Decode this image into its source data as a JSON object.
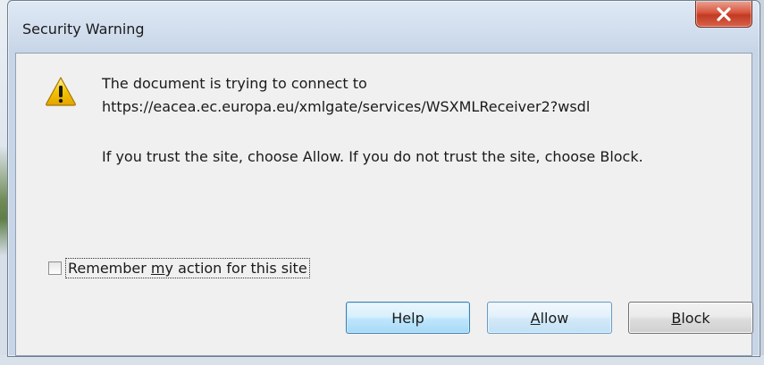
{
  "window": {
    "title": "Security Warning",
    "close_glyph": "X"
  },
  "message": {
    "line1": "The document is trying to connect to",
    "line2": "https://eacea.ec.europa.eu/xmlgate/services/WSXMLReceiver2?wsdl",
    "line3": "If you trust the site, choose Allow. If you do not trust the site, choose Block."
  },
  "remember": {
    "label_before": "Remember ",
    "label_mnemonic": "m",
    "label_after": "y action for this site",
    "checked": false
  },
  "buttons": {
    "help": "Help",
    "allow_mnemonic": "A",
    "allow_rest": "llow",
    "block_mnemonic": "B",
    "block_rest": "lock"
  },
  "icons": {
    "warning": "warning-icon",
    "close": "close-icon"
  },
  "colors": {
    "close_button": "#c23a22",
    "warning_yellow": "#f5c400",
    "focus_button_border": "#3c7fb1"
  }
}
